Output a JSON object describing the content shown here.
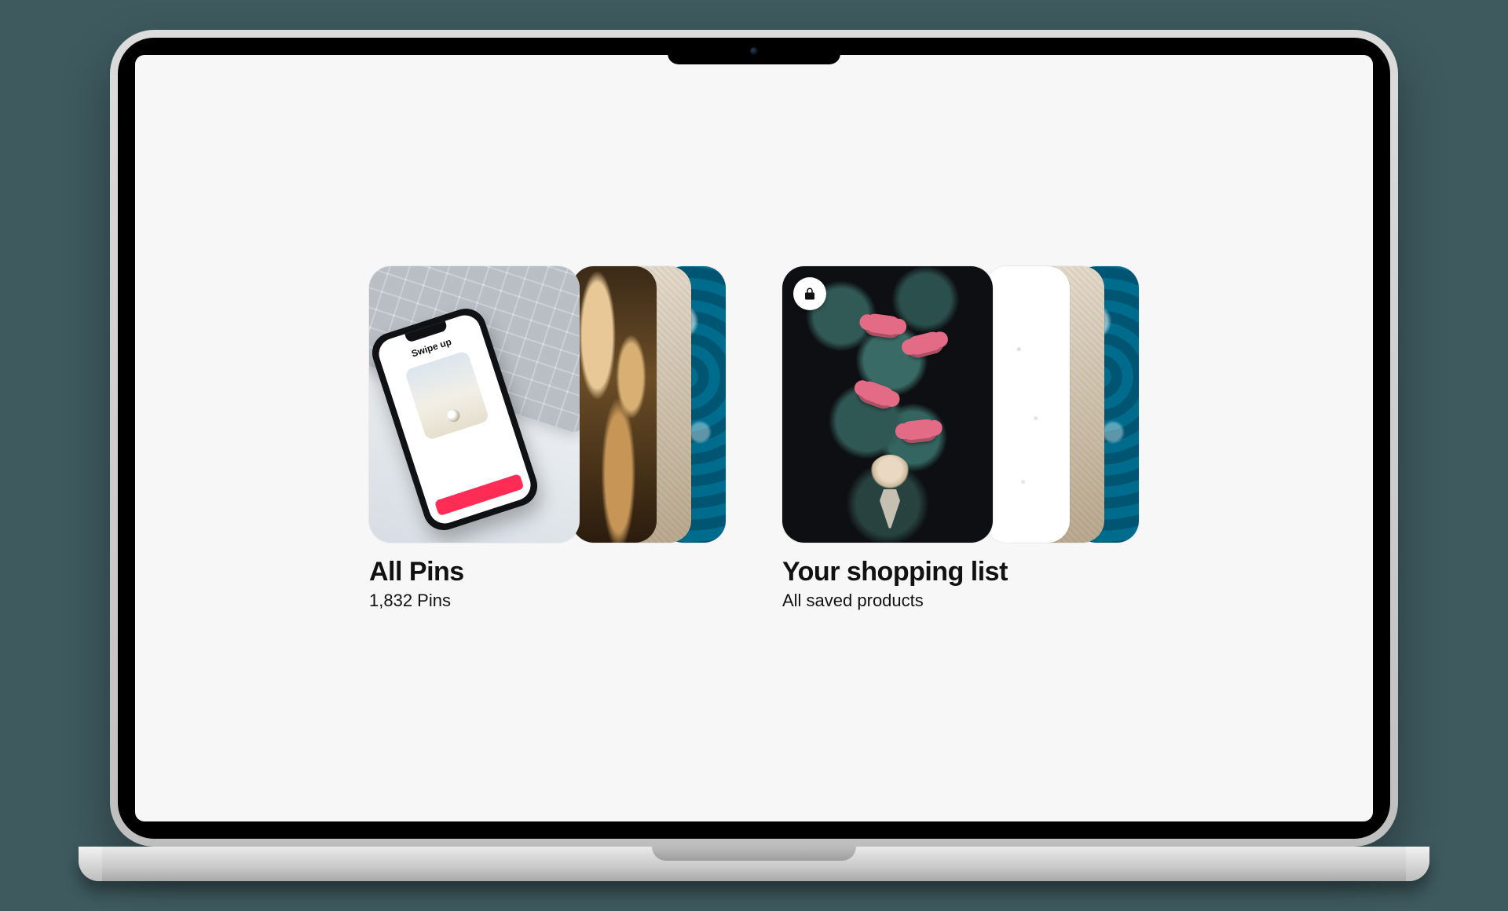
{
  "phone_mock": {
    "swipe_label": "Swipe up"
  },
  "boards": {
    "all_pins": {
      "title": "All Pins",
      "subtitle": "1,832 Pins",
      "locked": false
    },
    "shopping_list": {
      "title": "Your shopping list",
      "subtitle": "All saved products",
      "locked": true
    }
  },
  "icons": {
    "lock": "lock-icon"
  }
}
